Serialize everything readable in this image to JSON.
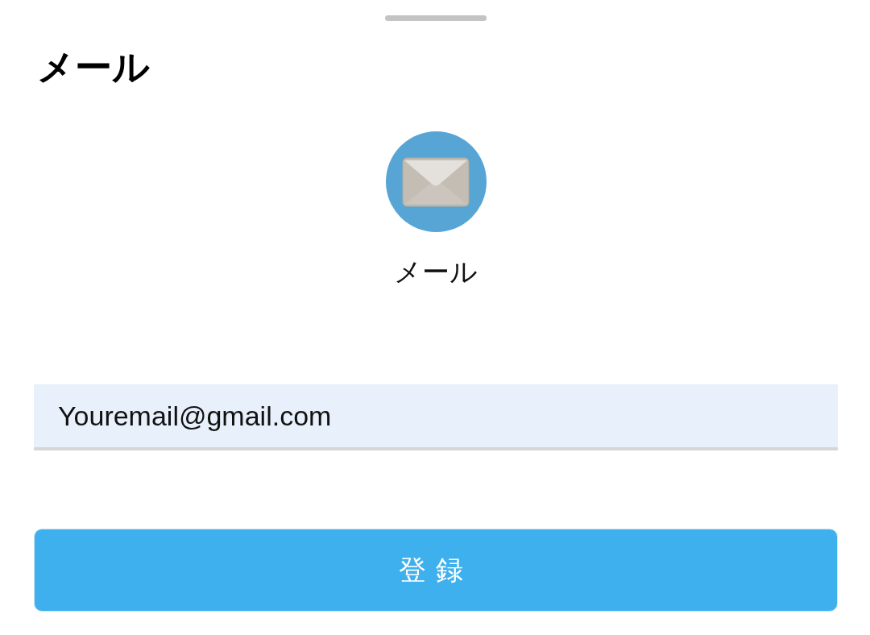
{
  "title": "メール",
  "account": {
    "label": "メール"
  },
  "email_field": {
    "value": "Youremail@gmail.com"
  },
  "submit_button": {
    "label": "登録"
  }
}
